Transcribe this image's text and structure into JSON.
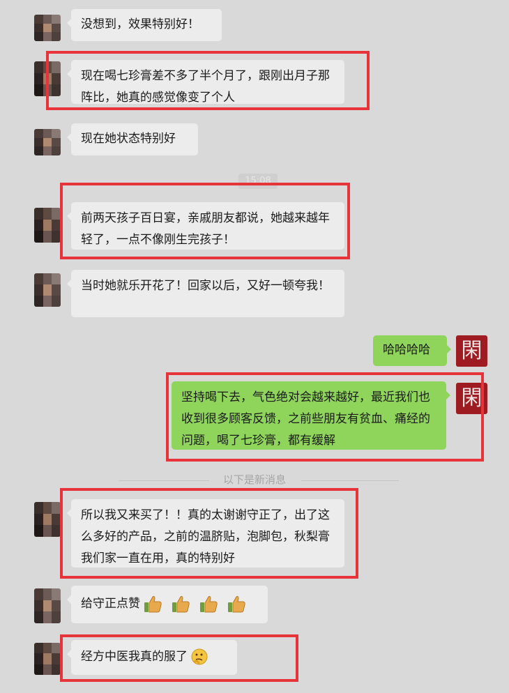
{
  "messages": [
    {
      "text": "没想到，效果特别好！"
    },
    {
      "text": "现在喝七珍膏差不多了半个月了，跟刚出月子那阵比，她真的感觉像变了个人"
    },
    {
      "text": "现在她状态特别好"
    },
    {
      "text": "前两天孩子百日宴，亲戚朋友都说，她越来越年轻了，一点不像刚生完孩子！"
    },
    {
      "text": "当时她就乐开花了！回家以后，又好一顿夸我！"
    },
    {
      "text": "哈哈哈哈"
    },
    {
      "text": "坚持喝下去，气色绝对会越来越好，最近我们也收到很多顾客反馈，之前些朋友有贫血、痛经的问题，喝了七珍膏，都有缓解"
    },
    {
      "text": "所以我又来买了！！真的太谢谢守正了，出了这么多好的产品，之前的温脐贴，泡脚包，秋梨膏我们家一直在用，真的特别好"
    },
    {
      "text": "给守正点赞"
    },
    {
      "text": "经方中医我真的服了"
    }
  ],
  "time_chip": "15:08",
  "divider_label": "以下是新消息",
  "my_avatar_glyph": "閑",
  "colors": {
    "background": "#d9d9d9",
    "incoming_bubble": "#ececec",
    "outgoing_bubble": "#8fd45b",
    "highlight": "#e8333b",
    "my_avatar": "#9e1b22"
  },
  "icons": [
    "thumbs-up-icon",
    "thumbs-up-icon",
    "thumbs-up-icon",
    "thumbs-up-icon",
    "thinking-face-icon"
  ]
}
